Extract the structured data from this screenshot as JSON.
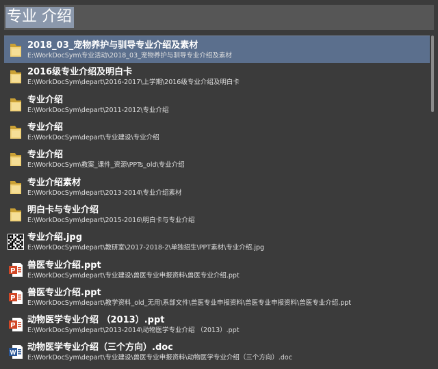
{
  "search": {
    "query": "专业 介绍"
  },
  "results": [
    {
      "type": "folder",
      "icon": "folder-icon",
      "title": "2018_03_宠物养护与驯导专业介绍及素材",
      "path": "E:\\WorkDocSym\\专业活动\\2018_03_宠物养护与驯导专业介绍及素材",
      "selected": true
    },
    {
      "type": "folder",
      "icon": "folder-icon",
      "title": "2016级专业介绍及明白卡",
      "path": "E:\\WorkDocSym\\depart\\2016-2017\\上学期\\2016级专业介绍及明白卡"
    },
    {
      "type": "folder",
      "icon": "folder-icon",
      "title": "专业介绍",
      "path": "E:\\WorkDocSym\\depart\\2011-2012\\专业介绍"
    },
    {
      "type": "folder",
      "icon": "folder-icon",
      "title": "专业介绍",
      "path": "E:\\WorkDocSym\\depart\\专业建设\\专业介绍"
    },
    {
      "type": "folder",
      "icon": "folder-icon",
      "title": "专业介绍",
      "path": "E:\\WorkDocSym\\教案_课件_资源\\PPTs_old\\专业介绍"
    },
    {
      "type": "folder",
      "icon": "folder-icon",
      "title": "专业介绍素材",
      "path": "E:\\WorkDocSym\\depart\\2013-2014\\专业介绍素材"
    },
    {
      "type": "folder",
      "icon": "folder-icon",
      "title": "明白卡与专业介绍",
      "path": "E:\\WorkDocSym\\depart\\2015-2016\\明白卡与专业介绍"
    },
    {
      "type": "image",
      "icon": "qr-image-icon",
      "title": "专业介绍.jpg",
      "path": "E:\\WorkDocSym\\depart\\教研室\\2017-2018-2\\单独招生\\PPT素材\\专业介绍.jpg"
    },
    {
      "type": "ppt",
      "icon": "powerpoint-icon",
      "title": "兽医专业介绍.ppt",
      "path": "E:\\WorkDocSym\\depart\\专业建设\\兽医专业申报资料\\兽医专业介绍.ppt"
    },
    {
      "type": "ppt",
      "icon": "powerpoint-icon",
      "title": "兽医专业介绍.ppt",
      "path": "E:\\WorkDocSym\\depart\\教学资料_old_无用\\系部文件\\兽医专业申报资料\\兽医专业申报资料\\兽医专业介绍.ppt"
    },
    {
      "type": "ppt",
      "icon": "powerpoint-icon",
      "title": "动物医学专业介绍 （2013）.ppt",
      "path": "E:\\WorkDocSym\\depart\\2013-2014\\动物医学专业介绍 （2013）.ppt"
    },
    {
      "type": "doc",
      "icon": "word-icon",
      "title": "动物医学专业介绍（三个方向）.doc",
      "path": "E:\\WorkDocSym\\depart\\专业建设\\兽医专业申报资料\\动物医学专业介绍（三个方向）.doc"
    }
  ],
  "colors": {
    "background": "#3b3b3b",
    "search_bar": "#565656",
    "query_highlight": "#8b98ac",
    "selected_row": "#5b6f8d",
    "folder": "#e8c25a",
    "powerpoint": "#d24726",
    "word": "#2b5797"
  }
}
